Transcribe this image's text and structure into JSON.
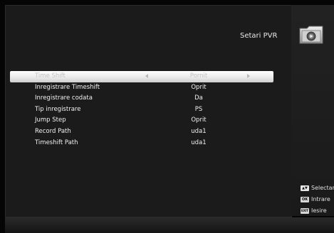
{
  "header": {
    "title": "Setari PVR",
    "icon": "media-folder-icon"
  },
  "menu": {
    "items": [
      {
        "label": "Time Shift",
        "value": "Pornit",
        "selected": true
      },
      {
        "label": "Inregistrare Timeshift",
        "value": "Oprit",
        "selected": false
      },
      {
        "label": "Inregistrare codata",
        "value": "Da",
        "selected": false
      },
      {
        "label": "Tip inregistrare",
        "value": "PS",
        "selected": false
      },
      {
        "label": "Jump Step",
        "value": "Oprit",
        "selected": false
      },
      {
        "label": "Record Path",
        "value": "uda1",
        "selected": false
      },
      {
        "label": "Timeshift Path",
        "value": "uda1",
        "selected": false
      }
    ]
  },
  "help": {
    "select": {
      "key": "▲▼",
      "label": "Selectare"
    },
    "enter": {
      "key": "OK",
      "label": "Intrare"
    },
    "exit": {
      "key": "EXIT",
      "label": "Iesire"
    }
  },
  "colors": {
    "background": "#050505",
    "panel": "#1b1b1b",
    "highlight": "#ffffff",
    "text": "#f2f2f2"
  }
}
